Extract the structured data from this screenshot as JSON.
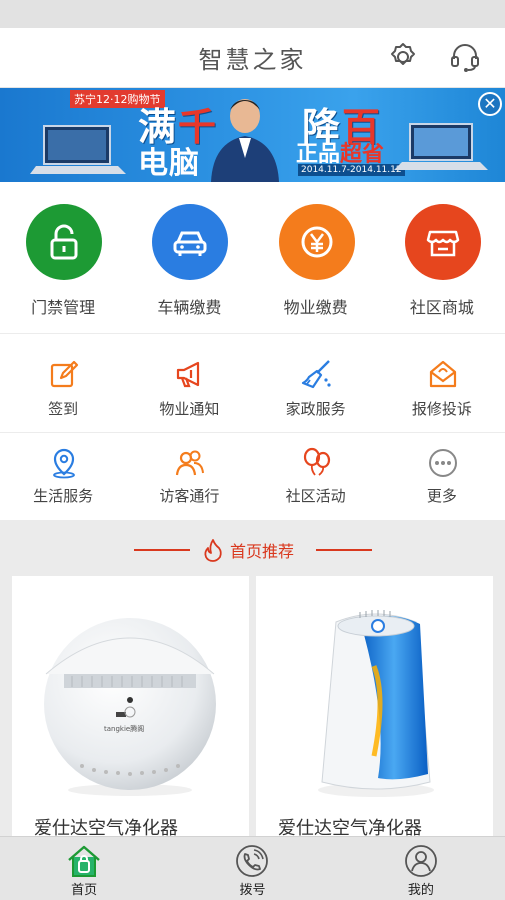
{
  "header": {
    "title": "智慧之家"
  },
  "banner": {
    "brand": "苏宁12·12购物节",
    "line1a": "满",
    "line1b": "千",
    "line1c": "降",
    "line1d": "百",
    "line2": "电脑",
    "promo_a": "正品",
    "promo_b": "超省",
    "date": "2014.11.7-2014.11.12"
  },
  "main_services": [
    {
      "label": "门禁管理",
      "color": "#1d9a34",
      "icon": "lock-icon"
    },
    {
      "label": "车辆缴费",
      "color": "#2a7de1",
      "icon": "car-icon"
    },
    {
      "label": "物业缴费",
      "color": "#f47c1c",
      "icon": "yen-icon"
    },
    {
      "label": "社区商城",
      "color": "#e6461e",
      "icon": "store-icon"
    }
  ],
  "sub_services_row1": [
    {
      "label": "签到",
      "icon": "edit-icon"
    },
    {
      "label": "物业通知",
      "icon": "megaphone-icon"
    },
    {
      "label": "家政服务",
      "icon": "broom-icon"
    },
    {
      "label": "报修投诉",
      "icon": "envelope-icon"
    }
  ],
  "sub_services_row2": [
    {
      "label": "生活服务",
      "icon": "location-icon"
    },
    {
      "label": "访客通行",
      "icon": "visitors-icon"
    },
    {
      "label": "社区活动",
      "icon": "balloons-icon"
    },
    {
      "label": "更多",
      "icon": "more-icon"
    }
  ],
  "recommend": {
    "title": "首页推荐",
    "products": [
      {
        "name": "爱仕达空气净化器",
        "logo_text": "tangkie腾阁"
      },
      {
        "name": "爱仕达空气净化器"
      }
    ]
  },
  "tabbar": [
    {
      "label": "首页",
      "icon": "home-icon"
    },
    {
      "label": "拨号",
      "icon": "phone-icon"
    },
    {
      "label": "我的",
      "icon": "profile-icon"
    }
  ],
  "colors": {
    "accent_red": "#d9381e",
    "icon_blue": "#2a7de1",
    "icon_orange": "#f47c1c",
    "icon_red": "#e6461e",
    "icon_green": "#1d9a34"
  }
}
